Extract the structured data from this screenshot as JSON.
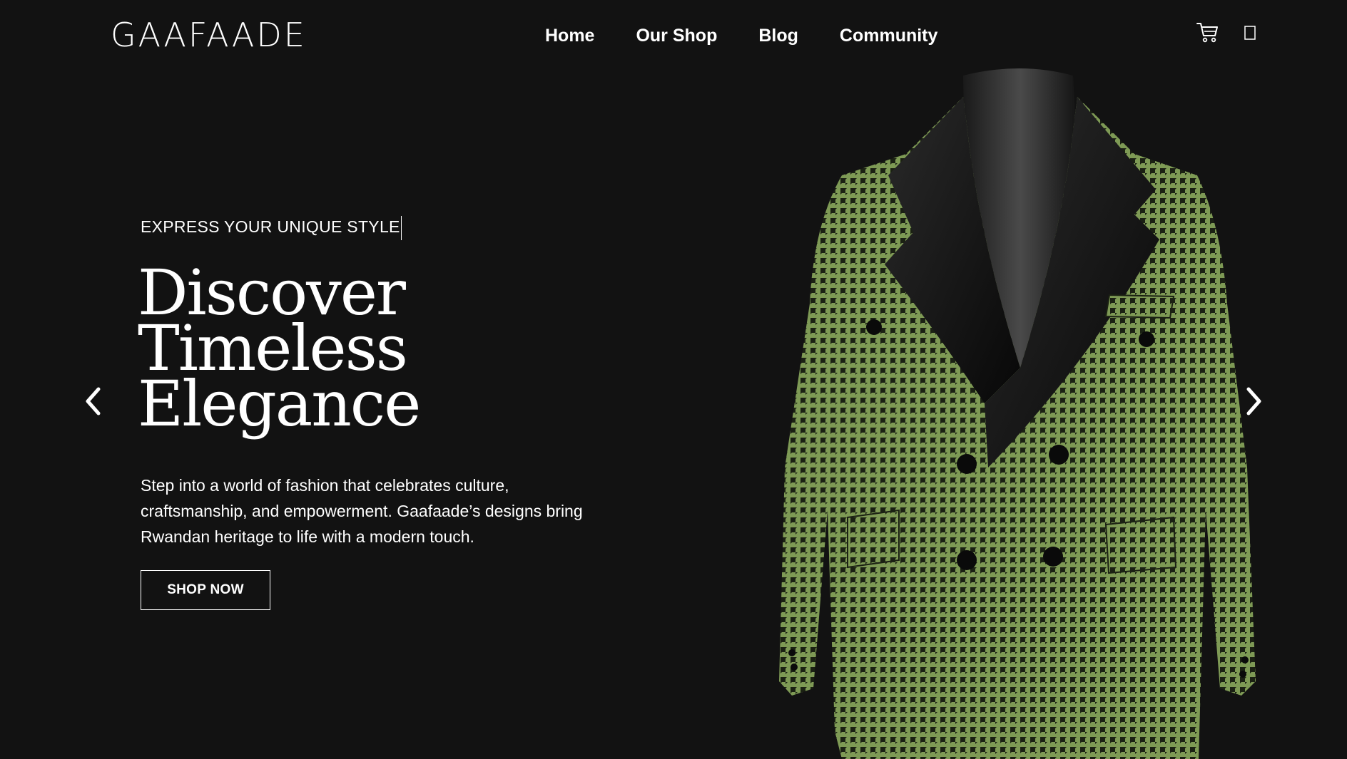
{
  "brand": {
    "logo_text": "GAAFAADE"
  },
  "nav": {
    "items": [
      {
        "label": "Home"
      },
      {
        "label": "Our Shop"
      },
      {
        "label": "Blog"
      },
      {
        "label": "Community"
      }
    ]
  },
  "header_icons": {
    "cart": "cart-icon",
    "profile": "profile-icon"
  },
  "hero": {
    "eyebrow": "EXPRESS YOUR UNIQUE STYLE",
    "headline_lines": [
      "Discover",
      "Timeless",
      "Elegance"
    ],
    "body": "Step into a world of fashion that celebrates culture, craftsmanship, and empowerment. Gaafaade’s designs bring Rwandan heritage to life with a modern touch.",
    "cta_label": "SHOP NOW"
  },
  "carousel": {
    "prev_icon": "chevron-left-icon",
    "next_icon": "chevron-right-icon"
  },
  "colors": {
    "background": "#121212",
    "text": "#ffffff",
    "jacket_green": "#7e9a55",
    "lapel_black": "#0c0c0c"
  }
}
